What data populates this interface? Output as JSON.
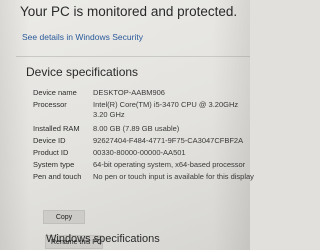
{
  "security": {
    "status_text": "Your PC is monitored and protected.",
    "details_link": "See details in Windows Security"
  },
  "device_specs": {
    "title": "Device specifications",
    "rows": [
      {
        "label": "Device name",
        "value": "DESKTOP-AABM906"
      },
      {
        "label": "Processor",
        "value": "Intel(R) Core(TM) i5-3470 CPU @ 3.20GHz   3.20 GHz"
      },
      {
        "label": "Installed RAM",
        "value": "8.00 GB (7.89 GB usable)"
      },
      {
        "label": "Device ID",
        "value": "92627404-F484-4771-9F75-CA3047CFBF2A"
      },
      {
        "label": "Product ID",
        "value": "00330-80000-00000-AA501"
      },
      {
        "label": "System type",
        "value": "64-bit operating system, x64-based processor"
      },
      {
        "label": "Pen and touch",
        "value": "No pen or touch input is available for this display"
      }
    ],
    "copy_button": "Copy",
    "rename_button": "Rename this PC"
  },
  "windows_specs": {
    "title": "Windows specifications"
  }
}
